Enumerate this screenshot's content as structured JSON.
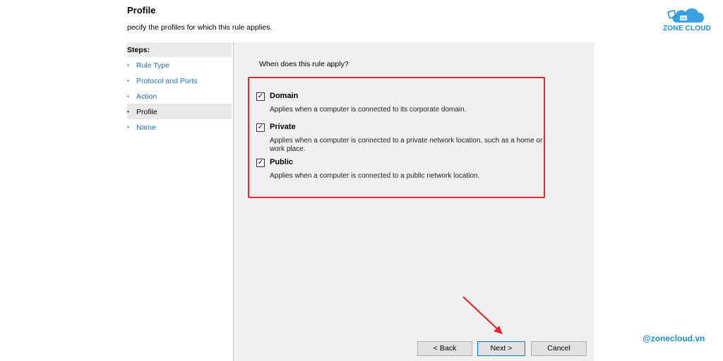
{
  "header": {
    "title": "Profile",
    "subtitle": "pecify the profiles for which this rule applies."
  },
  "steps": {
    "header": "Steps:",
    "bullet": "•",
    "items": [
      {
        "label": "Rule Type"
      },
      {
        "label": "Protocol and Ports"
      },
      {
        "label": "Action"
      },
      {
        "label": "Profile"
      },
      {
        "label": "Name"
      }
    ]
  },
  "main": {
    "question": "When does this rule apply?",
    "options": [
      {
        "label": "Domain",
        "checked": true,
        "description": "Applies when a computer is connected to its corporate domain."
      },
      {
        "label": "Private",
        "checked": true,
        "description": "Applies when a computer is connected to a private network location, such as a home or work place."
      },
      {
        "label": "Public",
        "checked": true,
        "description": "Applies when a computer is connected to a public network location."
      }
    ],
    "check_mark": "✓"
  },
  "buttons": {
    "back": "< Back",
    "next": "Next >",
    "cancel": "Cancel"
  },
  "branding": {
    "logo_text": "ZONE CLOUD",
    "handle": "@zonecloud.vn",
    "accent": "#1f8ed4",
    "highlight": "#e8262b"
  }
}
